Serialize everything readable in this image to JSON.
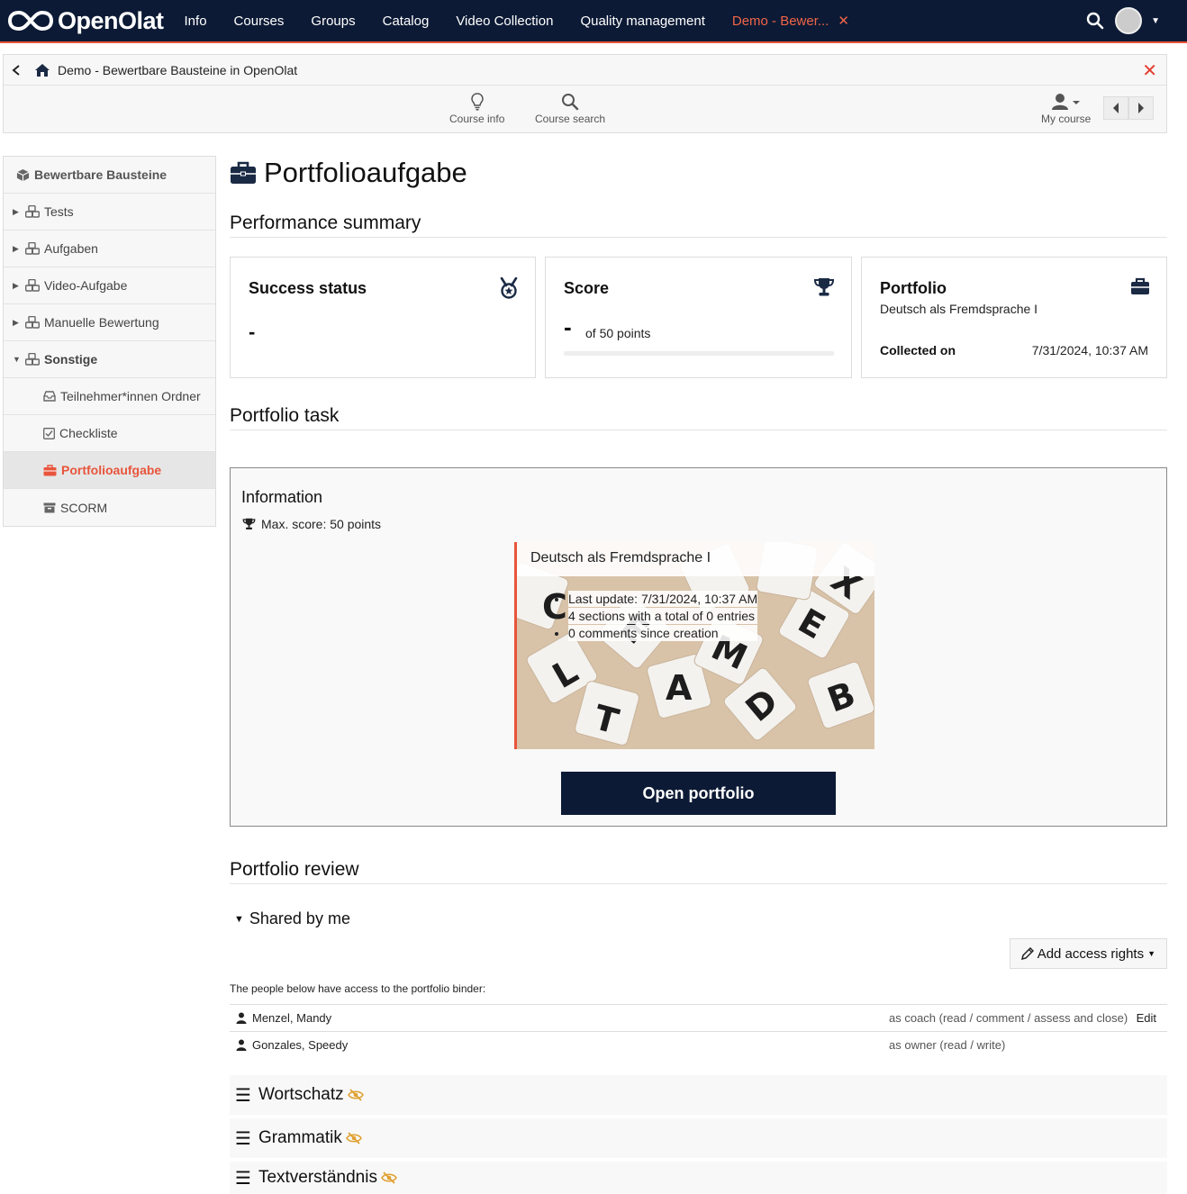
{
  "nav": {
    "brand": "OpenOlat",
    "items": [
      "Info",
      "Courses",
      "Groups",
      "Catalog",
      "Video Collection",
      "Quality management"
    ],
    "active_tab": "Demo - Bewer...",
    "active_close": "✕"
  },
  "course": {
    "breadcrumb": "Demo - Bewertbare Bausteine in OpenOlat",
    "tools": {
      "info": "Course info",
      "search": "Course search",
      "my_course": "My course"
    }
  },
  "sidebar": {
    "root": "Bewertbare Bausteine",
    "items": [
      {
        "label": "Tests"
      },
      {
        "label": "Aufgaben"
      },
      {
        "label": "Video-Aufgabe"
      },
      {
        "label": "Manuelle Bewertung"
      },
      {
        "label": "Sonstige"
      },
      {
        "label": "Teilnehmer*innen Ordner"
      },
      {
        "label": "Checkliste"
      },
      {
        "label": "Portfolioaufgabe"
      },
      {
        "label": "SCORM"
      }
    ]
  },
  "page": {
    "title": "Portfolioaufgabe",
    "performance_heading": "Performance summary",
    "success": {
      "title": "Success status",
      "value": "-"
    },
    "score": {
      "title": "Score",
      "value": "-",
      "suffix": "of 50 points"
    },
    "portfolio": {
      "title": "Portfolio",
      "name": "Deutsch als Fremdsprache I",
      "collected_label": "Collected on",
      "collected_value": "7/31/2024, 10:37 AM"
    },
    "task_heading": "Portfolio task",
    "info_heading": "Information",
    "max_score": "Max. score: 50 points",
    "binder": {
      "title": "Deutsch als Fremdsprache I",
      "lines": [
        "Last update: 7/31/2024, 10:37 AM",
        "4 sections with a total of 0 entries",
        "0 comments since creation"
      ]
    },
    "open_button": "Open portfolio",
    "review_heading": "Portfolio review",
    "shared_by_me": "Shared by me",
    "add_access": "Add access rights",
    "access_intro": "The people below have access to the portfolio binder:",
    "access": [
      {
        "name": "Menzel, Mandy",
        "role": "as coach (read / comment / assess and close)",
        "edit": "Edit"
      },
      {
        "name": "Gonzales, Speedy",
        "role": "as owner (read / write)",
        "edit": ""
      }
    ],
    "sections": [
      "Wortschatz",
      "Grammatik",
      "Textverständnis"
    ]
  }
}
